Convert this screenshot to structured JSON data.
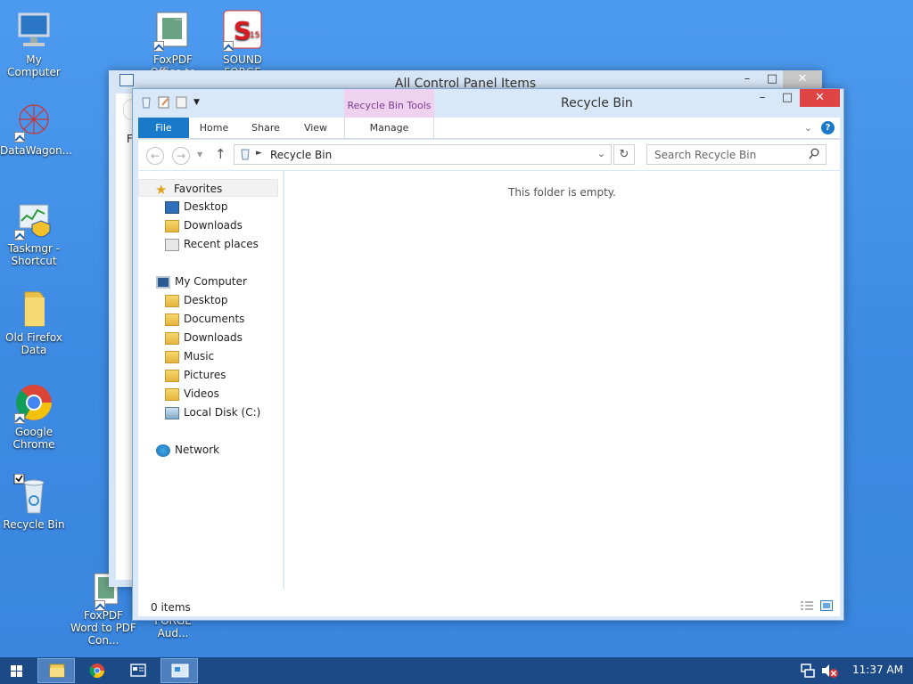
{
  "desktop_icons": [
    {
      "label": "My Computer"
    },
    {
      "label": "FoxPDF Office to PDF C..."
    },
    {
      "label": "SOUND FORGE Aud..."
    },
    {
      "label": "DataWagon..."
    },
    {
      "label": "Taskmgr - Shortcut"
    },
    {
      "label": "Old Firefox Data"
    },
    {
      "label": "Google Chrome"
    },
    {
      "label": "Recycle Bin"
    },
    {
      "label": "FoxPDF Word to PDF Con..."
    },
    {
      "label": "FORGE Aud..."
    }
  ],
  "control_panel": {
    "title": "All Control Panel Items",
    "fragment": "Fi"
  },
  "recycle_bin": {
    "title": "Recycle Bin",
    "context_tab": "Recycle Bin Tools",
    "ribbon_tabs": [
      "File",
      "Home",
      "Share",
      "View",
      "Manage"
    ],
    "address": "Recycle Bin",
    "search_placeholder": "Search Recycle Bin",
    "empty_text": "This folder is empty.",
    "status": "0 items",
    "nav": {
      "favorites_header": "Favorites",
      "favorites": [
        "Desktop",
        "Downloads",
        "Recent places"
      ],
      "computer_header": "My Computer",
      "computer": [
        "Desktop",
        "Documents",
        "Downloads",
        "Music",
        "Pictures",
        "Videos",
        "Local Disk (C:)"
      ],
      "network": "Network"
    }
  },
  "taskbar": {
    "clock": "11:37 AM"
  },
  "colors": {
    "accent": "#1979ca",
    "close": "#e04343",
    "context": "#eed2f0",
    "taskbar": "#1c4a86"
  }
}
